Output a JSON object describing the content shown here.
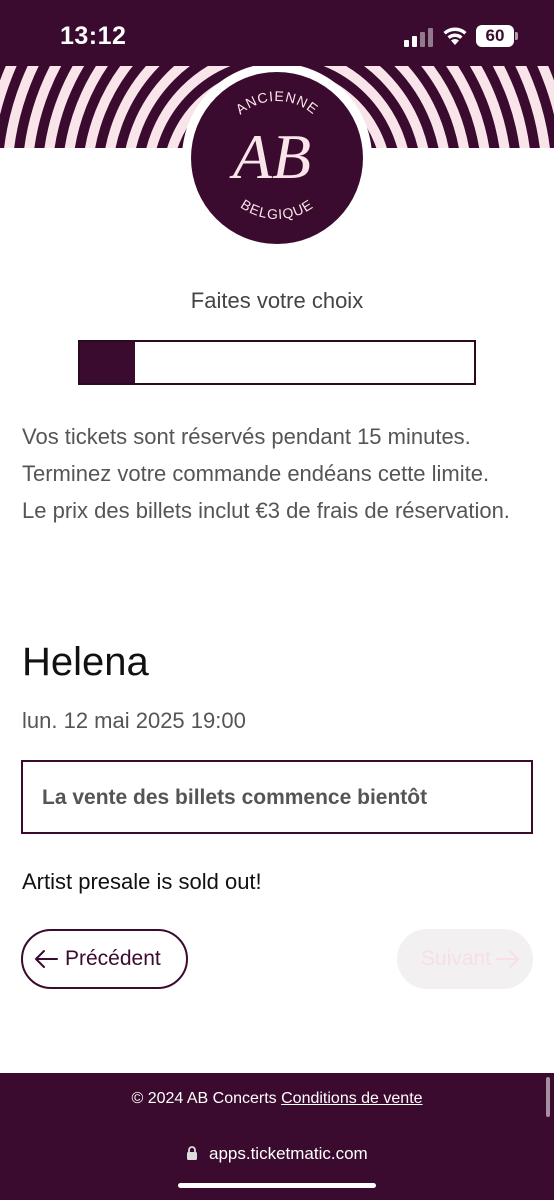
{
  "status_bar": {
    "time": "13:12",
    "battery": "60"
  },
  "logo": {
    "initials": "AB",
    "top_text": "ANCIENNE",
    "bottom_text": "BELGIQUE"
  },
  "checkout": {
    "step_title": "Faites votre choix",
    "progress_fraction": 0.14,
    "info_lines": [
      "Vos tickets sont réservés pendant 15 minutes.",
      "Terminez votre commande endéans cette limite.",
      "Le prix des billets inclut €3 de frais de réservation."
    ]
  },
  "event": {
    "title": "Helena",
    "datetime": "lun. 12 mai 2025 19:00",
    "sale_notice": "La vente des billets commence bientôt",
    "presale_message": "Artist presale is sold out!"
  },
  "navigation": {
    "previous_label": "Précédent",
    "next_label": "Suivant"
  },
  "footer": {
    "copyright": "© 2024 AB Concerts",
    "terms_link": "Conditions de vente"
  },
  "browser": {
    "url": "apps.ticketmatic.com"
  },
  "colors": {
    "brand": "#3a0b2e",
    "stripe": "#f9e4ea",
    "disabled_bg": "#f3f0f2"
  }
}
